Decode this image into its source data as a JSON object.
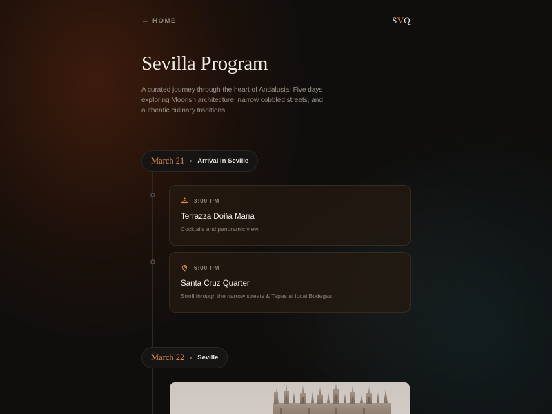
{
  "nav": {
    "home_label": "HOME",
    "brand_prefix": "S",
    "brand_accent": "V",
    "brand_suffix": "Q"
  },
  "page": {
    "title": "Sevilla Program",
    "intro": "A curated journey through the heart of Andalusia. Five days exploring Moorish architecture, narrow cobbled streets, and authentic culinary traditions."
  },
  "days": [
    {
      "date": "March 21",
      "place": "Arrival in Seville",
      "events": [
        {
          "icon": "sunset-icon",
          "time": "3:00 PM",
          "title": "Terrazza Doña Maria",
          "desc": "Cocktails and panoramic view."
        },
        {
          "icon": "map-pin-icon",
          "time": "6:00 PM",
          "title": "Santa Cruz Quarter",
          "desc": "Stroll through the narrow streets & Tapas at local Bodegas."
        }
      ]
    },
    {
      "date": "March 22",
      "place": "Seville",
      "events": []
    }
  ],
  "colors": {
    "accent": "#d98a45",
    "background": "#0f0e0d",
    "card": "#261a10",
    "text": "#f1ece5",
    "muted": "#8b8279"
  }
}
